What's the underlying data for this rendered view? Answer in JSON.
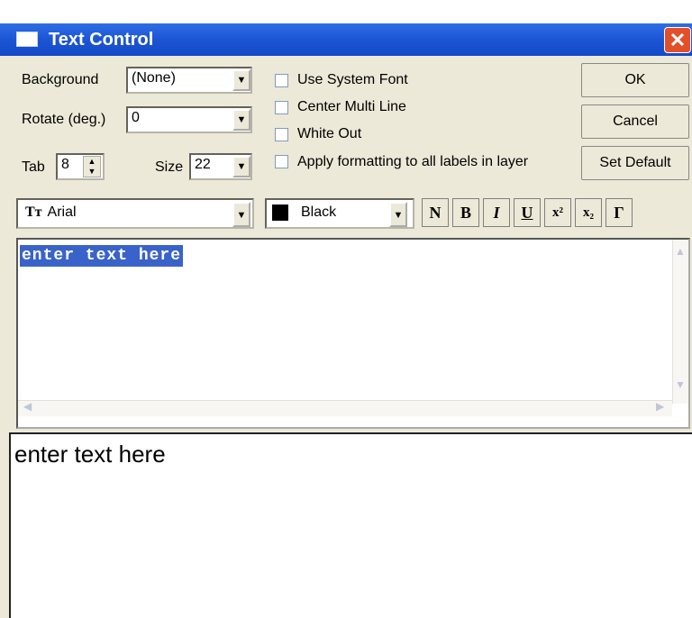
{
  "window": {
    "title": "Text Control",
    "close_symbol": "✕"
  },
  "background": {
    "label": "Background",
    "value": "(None)"
  },
  "rotate": {
    "label": "Rotate (deg.)",
    "value": "0"
  },
  "tab": {
    "label": "Tab",
    "value": "8"
  },
  "size": {
    "label": "Size",
    "value": "22"
  },
  "checkboxes": {
    "system_font": "Use System Font",
    "center_multi": "Center Multi Line",
    "white_out": "White Out",
    "apply_all": "Apply formatting to all labels in layer"
  },
  "buttons": {
    "ok": "OK",
    "cancel": "Cancel",
    "set_default": "Set Default"
  },
  "font": {
    "icon_text": "Tт",
    "value": "Arial"
  },
  "color": {
    "value": "Black",
    "swatch": "#000000"
  },
  "format_buttons": {
    "normal": "N",
    "bold": "B",
    "italic": "I",
    "underline": "U",
    "superscript": "x²",
    "subscript": "x₂",
    "greek": "Γ"
  },
  "editor": {
    "text": "enter text here"
  },
  "preview": {
    "text": "enter text here"
  },
  "arrow": "▼"
}
